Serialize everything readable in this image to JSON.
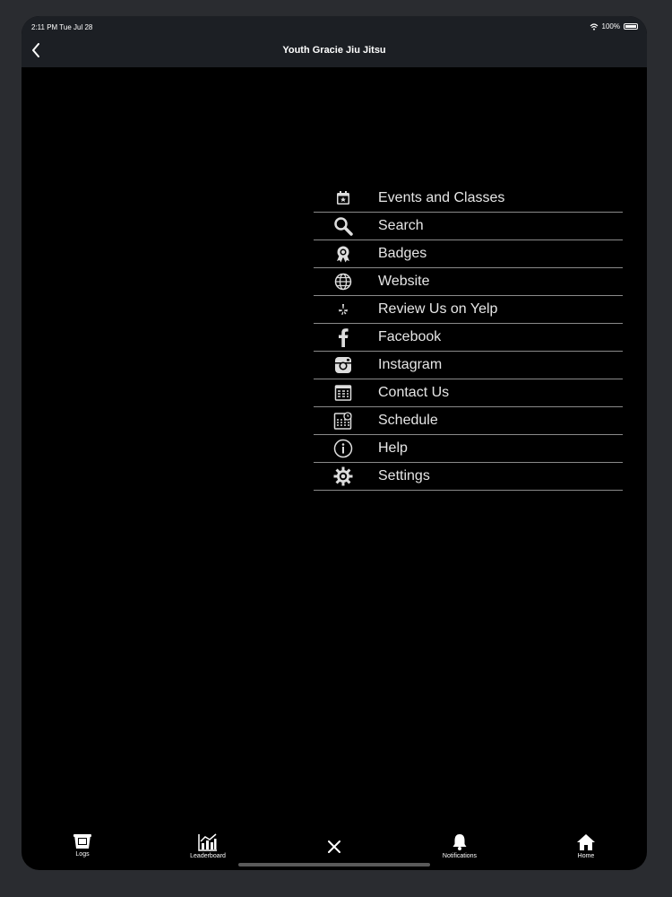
{
  "status_bar": {
    "time": "2:11 PM   Tue Jul 28",
    "battery": "100%"
  },
  "nav": {
    "title": "Youth Gracie Jiu Jitsu"
  },
  "menu": {
    "items": [
      {
        "label": "Events and Classes",
        "icon": "calendar-star-icon"
      },
      {
        "label": "Search",
        "icon": "search-icon"
      },
      {
        "label": "Badges",
        "icon": "badge-ribbon-icon"
      },
      {
        "label": "Website",
        "icon": "globe-icon"
      },
      {
        "label": "Review Us on Yelp",
        "icon": "yelp-icon"
      },
      {
        "label": "Facebook",
        "icon": "facebook-icon"
      },
      {
        "label": "Instagram",
        "icon": "instagram-icon"
      },
      {
        "label": "Contact Us",
        "icon": "contact-card-icon"
      },
      {
        "label": "Schedule",
        "icon": "schedule-calendar-icon"
      },
      {
        "label": "Help",
        "icon": "info-icon"
      },
      {
        "label": "Settings",
        "icon": "gear-icon"
      }
    ]
  },
  "tabbar": {
    "logs": "Logs",
    "leaderboard": "Leaderboard",
    "close": "close-icon",
    "notifications": "Notifications",
    "home": "Home"
  }
}
